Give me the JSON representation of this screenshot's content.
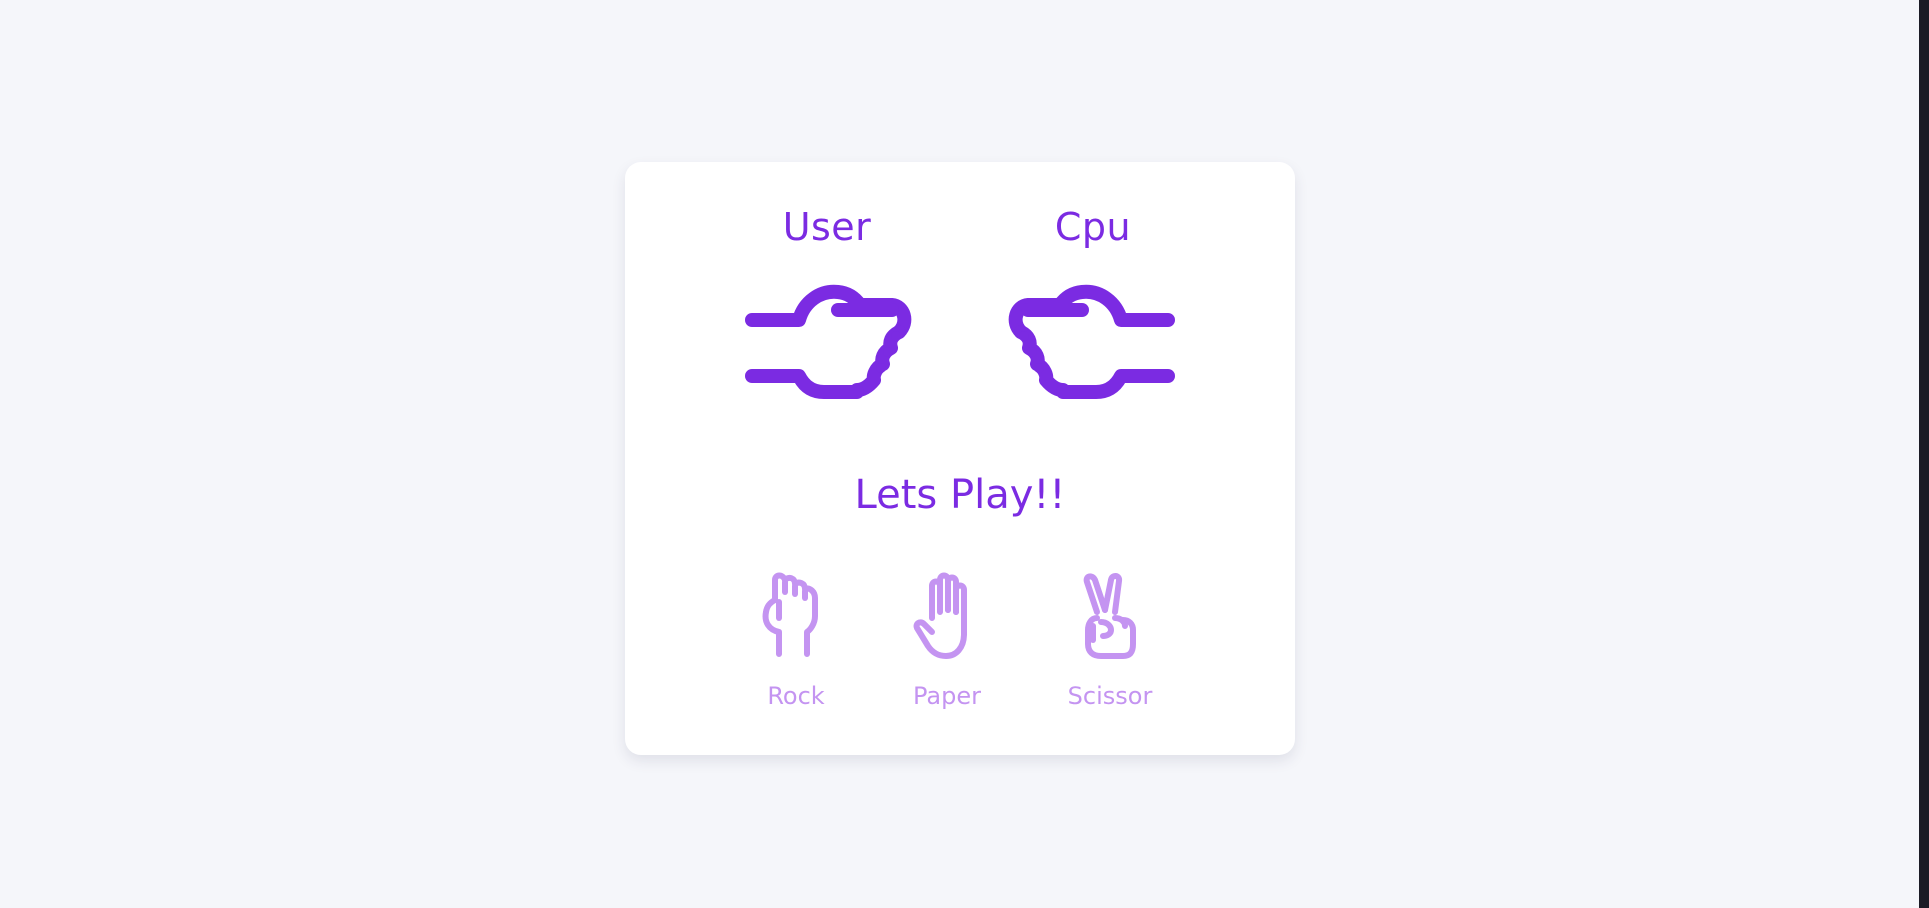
{
  "players": {
    "user_label": "User",
    "cpu_label": "Cpu"
  },
  "status": "Lets Play!!",
  "choices": [
    {
      "label": "Rock",
      "icon": "rock-hand-icon"
    },
    {
      "label": "Paper",
      "icon": "paper-hand-icon"
    },
    {
      "label": "Scissor",
      "icon": "scissor-hand-icon"
    }
  ],
  "colors": {
    "accent": "#7b2be2",
    "accent_light": "#c494f1",
    "background": "#f5f6fa",
    "card": "#ffffff"
  }
}
